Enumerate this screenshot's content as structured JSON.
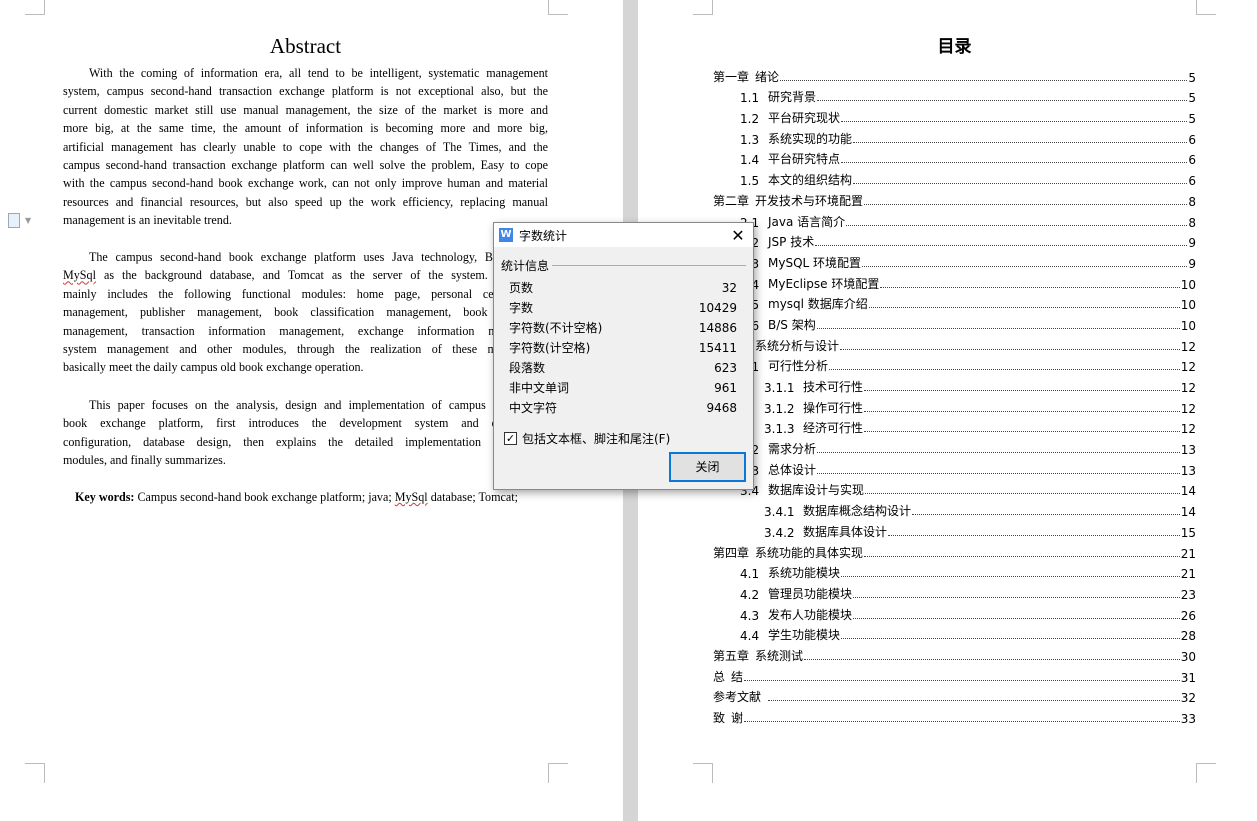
{
  "abstract": {
    "title": "Abstract",
    "p1": [
      "With the coming of information era, all tend to be intelligent, systematic management",
      "system, campus second-hand transaction exchange platform is not exceptional also, but the",
      "current domestic market still use manual management, the size of the market is more and",
      "more big, at the same time, the amount of information is becoming more and more big,",
      "artificial management has clearly unable to cope with the changes of The Times, and the",
      "campus second-hand transaction exchange platform can well solve the problem, Easy to cope",
      "with the campus second-hand book exchange work, can not only improve human and material",
      "resources and financial resources, but also speed up the work efficiency, replacing manual",
      "management is an inevitable trend."
    ],
    "p2": [
      "The campus second-hand book exchange platform uses Java technology, B/S",
      "MySql as the background database, and Tomcat as the server of the system. T",
      "mainly includes the following functional modules: home page, personal cent",
      "management, publisher management, book classification management, book i",
      "management, transaction information management, exchange information ma",
      "system management and other modules, through the realization of these mo",
      "basically meet the daily campus old book exchange operation."
    ],
    "p3": [
      "This paper focuses on the analysis, design and implementation of campus se",
      "book exchange platform, first introduces the development system and en",
      "configuration, database design, then explains the detailed implementation of",
      "modules, and finally summarizes."
    ],
    "kw_label": "Key words:",
    "kw_text": " Campus second-hand book exchange platform; java; MySql database; Tomcat;"
  },
  "toc": {
    "title": "目录",
    "entries": [
      {
        "num": "第一章",
        "title": "绪论",
        "page": "5",
        "level": 0
      },
      {
        "num": "1.1",
        "title": "研究背景",
        "page": "5",
        "level": 1
      },
      {
        "num": "1.2",
        "title": "平台研究现状",
        "page": "5",
        "level": 1
      },
      {
        "num": "1.3",
        "title": "系统实现的功能",
        "page": "6",
        "level": 1
      },
      {
        "num": "1.4",
        "title": "平台研究特点",
        "page": "6",
        "level": 1
      },
      {
        "num": "1.5",
        "title": "本文的组织结构",
        "page": "6",
        "level": 1
      },
      {
        "num": "第二章",
        "title": "开发技术与环境配置",
        "page": "8",
        "level": 0
      },
      {
        "num": "2.1",
        "title": "Java 语言简介",
        "page": "8",
        "level": 1
      },
      {
        "num": "2.2",
        "title": "JSP 技术",
        "page": "9",
        "level": 1
      },
      {
        "num": "2.3",
        "title": "MySQL 环境配置",
        "page": "9",
        "level": 1
      },
      {
        "num": "2.4",
        "title": "MyEclipse 环境配置",
        "page": "10",
        "level": 1
      },
      {
        "num": "2.5",
        "title": "mysql 数据库介绍",
        "page": "10",
        "level": 1
      },
      {
        "num": "2.6",
        "title": "B/S 架构",
        "page": "10",
        "level": 1
      },
      {
        "num": "第三章",
        "title": "系统分析与设计",
        "page": "12",
        "level": 0
      },
      {
        "num": "3.1",
        "title": "可行性分析",
        "page": "12",
        "level": 1
      },
      {
        "num": "3.1.1",
        "title": "技术可行性",
        "page": "12",
        "level": 2
      },
      {
        "num": "3.1.2",
        "title": "操作可行性",
        "page": "12",
        "level": 2
      },
      {
        "num": "3.1.3",
        "title": "经济可行性",
        "page": "12",
        "level": 2
      },
      {
        "num": "3.2",
        "title": "需求分析",
        "page": "13",
        "level": 1
      },
      {
        "num": "3.3",
        "title": "总体设计",
        "page": "13",
        "level": 1
      },
      {
        "num": "3.4",
        "title": "数据库设计与实现",
        "page": "14",
        "level": 1
      },
      {
        "num": "3.4.1",
        "title": "数据库概念结构设计",
        "page": "14",
        "level": 2
      },
      {
        "num": "3.4.2",
        "title": "数据库具体设计",
        "page": "15",
        "level": 2
      },
      {
        "num": "第四章",
        "title": "系统功能的具体实现",
        "page": "21",
        "level": 0
      },
      {
        "num": "4.1",
        "title": "系统功能模块",
        "page": "21",
        "level": 1
      },
      {
        "num": "4.2",
        "title": "管理员功能模块",
        "page": "23",
        "level": 1
      },
      {
        "num": "4.3",
        "title": "发布人功能模块",
        "page": "26",
        "level": 1
      },
      {
        "num": "4.4",
        "title": "学生功能模块",
        "page": "28",
        "level": 1
      },
      {
        "num": "第五章",
        "title": "系统测试",
        "page": "30",
        "level": 0
      },
      {
        "num": "总",
        "title": "结",
        "page": "31",
        "level": 0
      },
      {
        "num": "参考文献",
        "title": "",
        "page": "32",
        "level": 0
      },
      {
        "num": "致",
        "title": "谢",
        "page": "33",
        "level": 0
      }
    ]
  },
  "dialog": {
    "title": "字数统计",
    "group": "统计信息",
    "stats": [
      {
        "label": "页数",
        "value": "32"
      },
      {
        "label": "字数",
        "value": "10429"
      },
      {
        "label": "字符数(不计空格)",
        "value": "14886"
      },
      {
        "label": "字符数(计空格)",
        "value": "15411"
      },
      {
        "label": "段落数",
        "value": "623"
      },
      {
        "label": "非中文单词",
        "value": "961"
      },
      {
        "label": "中文字符",
        "value": "9468"
      }
    ],
    "checkbox_label": "包括文本框、脚注和尾注(F)",
    "checkbox_checked": true,
    "close_label": "关闭",
    "accent": "#0a78d7"
  }
}
